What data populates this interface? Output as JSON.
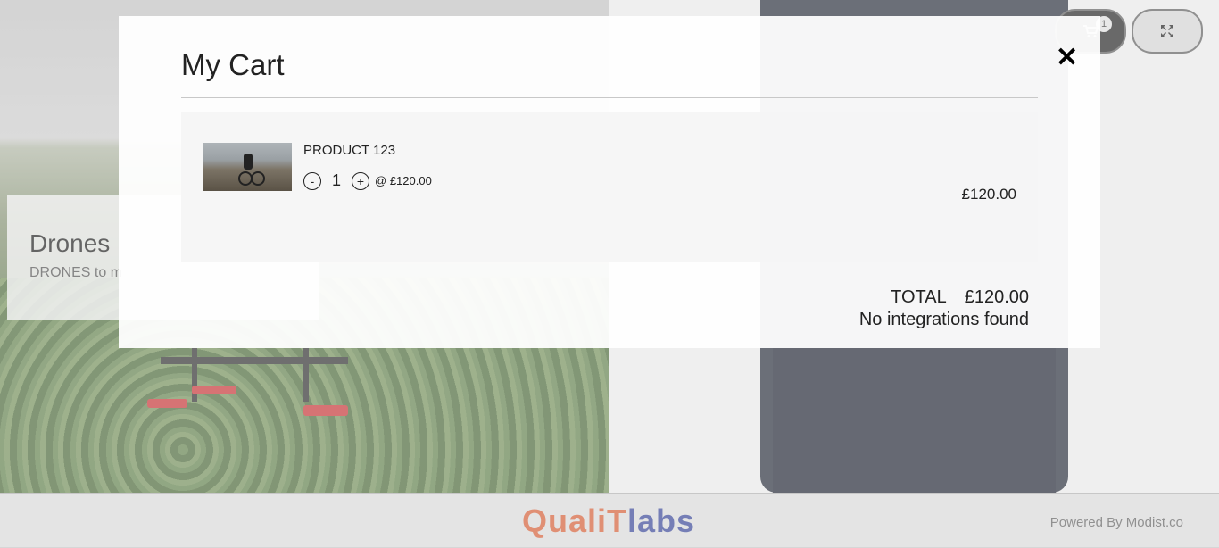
{
  "background": {
    "hero_title": "Drones",
    "hero_sub": "DRONES to m"
  },
  "header": {
    "cart_count": "1",
    "cart_icon": "cart-icon",
    "expand_icon": "expand-icon"
  },
  "modal": {
    "title": "My Cart",
    "close_glyph": "✕",
    "items": [
      {
        "name": "PRODUCT 123",
        "qty": "1",
        "minus": "-",
        "plus": "+",
        "unit_price": "@ £120.00",
        "line_total": "£120.00"
      }
    ],
    "total_label": "TOTAL",
    "total_value": "£120.00",
    "integrations_text": "No integrations found"
  },
  "footer": {
    "logo_part1": "QualiT",
    "logo_part2": "labs",
    "powered_by": "Powered By Modist.co"
  },
  "colors": {
    "logo_orange": "#d0542a",
    "logo_blue": "#2b3a8f"
  }
}
